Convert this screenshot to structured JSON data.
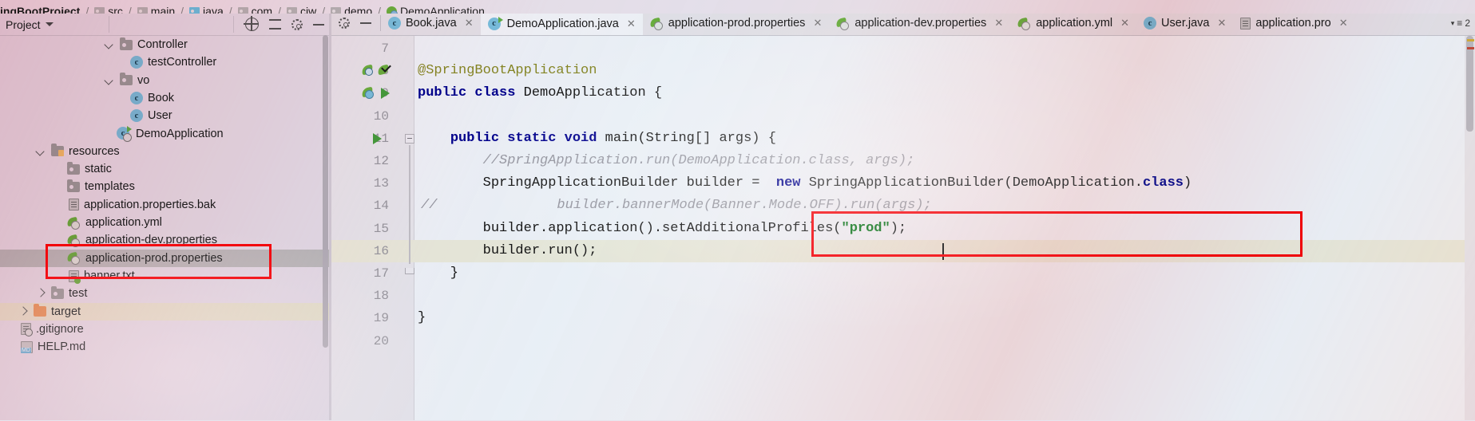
{
  "breadcrumb": {
    "items": [
      {
        "label": "ingBootProject",
        "icon": "project-icon",
        "bold": true
      },
      {
        "label": "src",
        "icon": "folder-icon"
      },
      {
        "label": "main",
        "icon": "folder-icon"
      },
      {
        "label": "java",
        "icon": "folder-blue-icon"
      },
      {
        "label": "com",
        "icon": "folder-icon"
      },
      {
        "label": "cjw",
        "icon": "folder-icon"
      },
      {
        "label": "demo",
        "icon": "folder-icon"
      },
      {
        "label": "DemoApplication",
        "icon": "spring-class-icon"
      }
    ],
    "separator": "/"
  },
  "left_panel": {
    "title": "Project",
    "icons": [
      "locate-icon",
      "collapse-all-icon",
      "settings-icon",
      "hide-icon"
    ],
    "tree": [
      {
        "label": "Controller",
        "icon": "folder-icon",
        "indent": 130,
        "twisty": "open",
        "state": "normal"
      },
      {
        "label": "testController",
        "icon": "java-class-icon",
        "indent": 163,
        "twisty": "none",
        "state": "normal"
      },
      {
        "label": "vo",
        "icon": "folder-icon",
        "indent": 130,
        "twisty": "open",
        "state": "normal"
      },
      {
        "label": "Book",
        "icon": "java-class-icon",
        "indent": 163,
        "twisty": "none",
        "state": "normal"
      },
      {
        "label": "User",
        "icon": "java-class-icon",
        "indent": 163,
        "twisty": "none",
        "state": "normal"
      },
      {
        "label": "DemoApplication",
        "icon": "spring-run-class-icon",
        "indent": 146,
        "twisty": "none",
        "state": "normal"
      },
      {
        "label": "resources",
        "icon": "resources-folder-icon",
        "indent": 44,
        "twisty": "open",
        "state": "normal"
      },
      {
        "label": "static",
        "icon": "folder-icon",
        "indent": 84,
        "twisty": "none",
        "state": "normal"
      },
      {
        "label": "templates",
        "icon": "folder-icon",
        "indent": 84,
        "twisty": "none",
        "state": "normal"
      },
      {
        "label": "application.properties.bak",
        "icon": "file-icon",
        "indent": 86,
        "twisty": "none",
        "state": "normal"
      },
      {
        "label": "application.yml",
        "icon": "spring-file-icon",
        "indent": 84,
        "twisty": "none",
        "state": "normal"
      },
      {
        "label": "application-dev.properties",
        "icon": "spring-file-icon",
        "indent": 84,
        "twisty": "none",
        "state": "normal"
      },
      {
        "label": "application-prod.properties",
        "icon": "spring-file-icon",
        "indent": 84,
        "twisty": "none",
        "state": "selected"
      },
      {
        "label": "banner.txt",
        "icon": "banner-file-icon",
        "indent": 86,
        "twisty": "none",
        "state": "normal"
      },
      {
        "label": "test",
        "icon": "folder-icon",
        "indent": 44,
        "twisty": "closed",
        "state": "normal"
      },
      {
        "label": "target",
        "icon": "target-folder-icon",
        "indent": 22,
        "twisty": "closed",
        "state": "highlight"
      },
      {
        "label": ".gitignore",
        "icon": "gitignore-file-icon",
        "indent": 26,
        "twisty": "none",
        "state": "normal"
      },
      {
        "label": "HELP.md",
        "icon": "markdown-file-icon",
        "indent": 26,
        "twisty": "none",
        "state": "normal"
      }
    ]
  },
  "annotations": {
    "color": "#fb0006",
    "sidebar_box_covers": [
      "application-dev.properties",
      "application-prod.properties"
    ],
    "editor_box_covers": [
      "line 15",
      "line 16"
    ]
  },
  "tabs": {
    "items": [
      {
        "label": "Book.java",
        "icon": "java-class-icon",
        "active": false
      },
      {
        "label": "DemoApplication.java",
        "icon": "spring-run-class-icon",
        "active": true
      },
      {
        "label": "application-prod.properties",
        "icon": "spring-file-icon",
        "active": false
      },
      {
        "label": "application-dev.properties",
        "icon": "spring-file-icon",
        "active": false
      },
      {
        "label": "application.yml",
        "icon": "spring-file-icon",
        "active": false
      },
      {
        "label": "User.java",
        "icon": "java-class-icon",
        "active": false
      },
      {
        "label": "application.pro",
        "icon": "file-icon",
        "active": false
      }
    ],
    "close_glyph": "✕",
    "overflow_label": "2",
    "overflow_icon": "tab-list-icon"
  },
  "editor": {
    "file": "DemoApplication.java",
    "cursor_line": 16,
    "lines": [
      {
        "num": "7",
        "tokens": [],
        "highlight": false
      },
      {
        "num": "8",
        "tokens": [
          {
            "t": "@SpringBootApplication",
            "c": "anno"
          }
        ],
        "highlight": false
      },
      {
        "num": "9",
        "tokens": [
          {
            "t": "public class ",
            "c": "kw"
          },
          {
            "t": "DemoApplication {",
            "c": "plain"
          }
        ],
        "highlight": false
      },
      {
        "num": "10",
        "tokens": [],
        "highlight": false
      },
      {
        "num": "11",
        "tokens": [
          {
            "t": "    ",
            "c": "plain"
          },
          {
            "t": "public static void ",
            "c": "kw"
          },
          {
            "t": "main(String[] args) {",
            "c": "plain"
          }
        ],
        "highlight": false
      },
      {
        "num": "12",
        "tokens": [
          {
            "t": "        //SpringApplication.run(DemoApplication.class, args);",
            "c": "cmt"
          }
        ],
        "highlight": false
      },
      {
        "num": "13",
        "tokens": [
          {
            "t": "        SpringApplicationBuilder builder =  ",
            "c": "plain"
          },
          {
            "t": "new ",
            "c": "kw"
          },
          {
            "t": "SpringApplicationBuilder(DemoApplication.",
            "c": "plain"
          },
          {
            "t": "class",
            "c": "kw"
          },
          {
            "t": ")",
            "c": "plain"
          }
        ],
        "highlight": false
      },
      {
        "num": "14",
        "tokens": [
          {
            "t": "            builder.bannerMode(Banner.Mode.OFF).run(args);",
            "c": "cmt"
          }
        ],
        "highlight": false,
        "gutter_comment": "//"
      },
      {
        "num": "15",
        "tokens": [
          {
            "t": "        builder.application().setAdditionalProfiles(",
            "c": "plain"
          },
          {
            "t": "\"prod\"",
            "c": "str"
          },
          {
            "t": ");",
            "c": "plain"
          }
        ],
        "highlight": false
      },
      {
        "num": "16",
        "tokens": [
          {
            "t": "        builder.run();",
            "c": "plain"
          }
        ],
        "highlight": true
      },
      {
        "num": "17",
        "tokens": [
          {
            "t": "    }",
            "c": "plain"
          }
        ],
        "highlight": false
      },
      {
        "num": "18",
        "tokens": [],
        "highlight": false
      },
      {
        "num": "19",
        "tokens": [
          {
            "t": "}",
            "c": "plain"
          }
        ],
        "highlight": false
      },
      {
        "num": "20",
        "tokens": [],
        "highlight": false
      }
    ],
    "gutter_markers": [
      {
        "line": "8",
        "icons": [
          "spring-bean-icon",
          "spring-check-icon"
        ]
      },
      {
        "line": "9",
        "icons": [
          "spring-bean-icon",
          "run-icon"
        ]
      },
      {
        "line": "11",
        "icons": [
          "run-icon",
          "fold-icon"
        ]
      },
      {
        "line": "17",
        "icons": [
          "fold-end-icon"
        ]
      }
    ]
  }
}
